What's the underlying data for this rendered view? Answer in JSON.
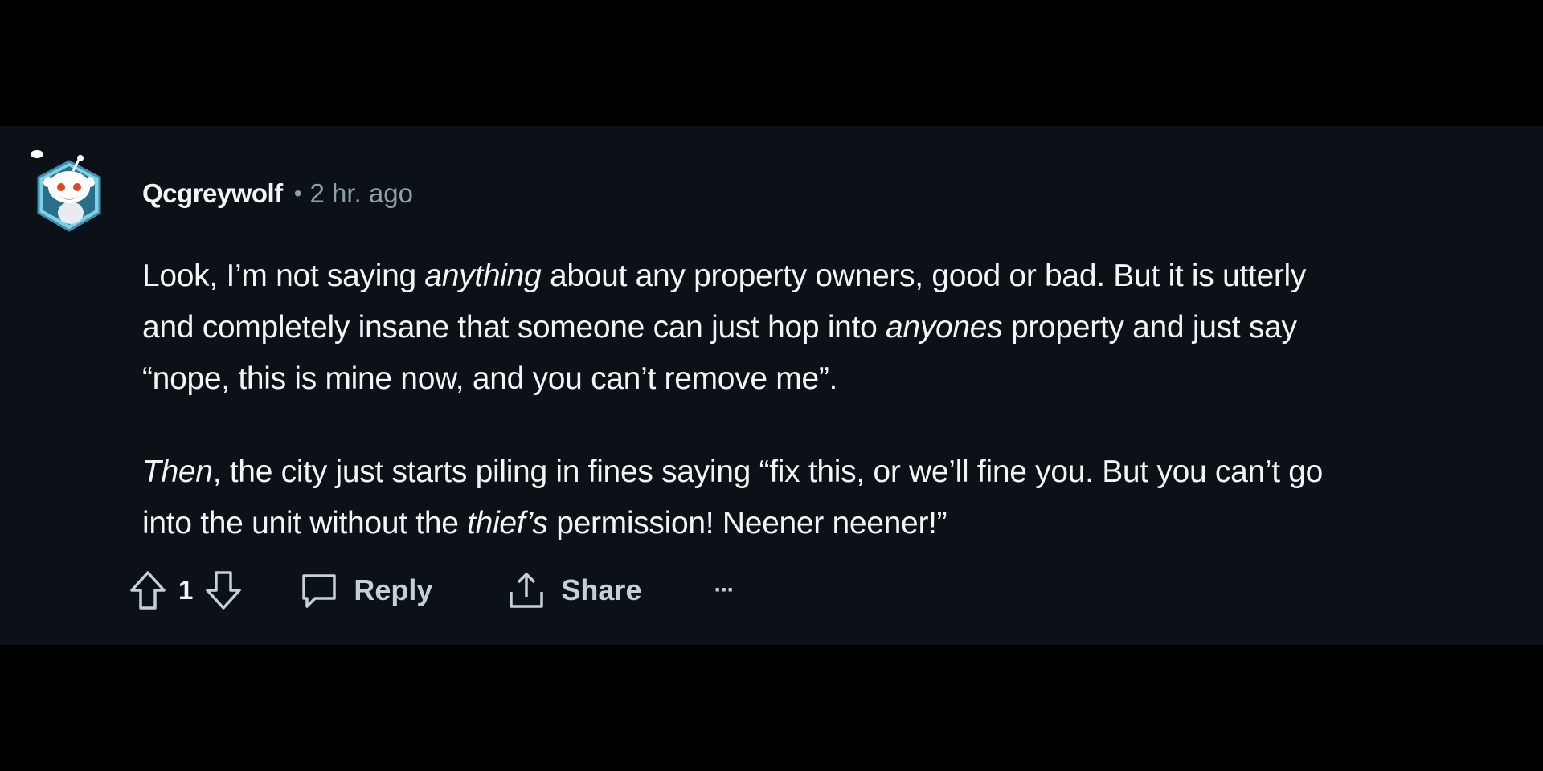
{
  "comment": {
    "username": "Qcgreywolf",
    "separator": "•",
    "time_ago": "2 hr. ago",
    "paragraphs": [
      {
        "lines": [
          [
            {
              "text": "Look, I’m not saying ",
              "italic": false
            },
            {
              "text": "anything",
              "italic": true
            },
            {
              "text": " about any property owners, good or bad. But it is utterly",
              "italic": false
            }
          ],
          [
            {
              "text": "and completely insane that someone can just hop into ",
              "italic": false
            },
            {
              "text": "anyones",
              "italic": true
            },
            {
              "text": " property and just say",
              "italic": false
            }
          ],
          [
            {
              "text": "“nope, this is mine now, and you can’t remove me”.",
              "italic": false
            }
          ]
        ]
      },
      {
        "lines": [
          [
            {
              "text": "Then",
              "italic": true
            },
            {
              "text": ", the city just starts piling in fines saying “fix this, or we’ll fine you. But you can’t go",
              "italic": false
            }
          ],
          [
            {
              "text": "into the unit without the ",
              "italic": false
            },
            {
              "text": "thief’s",
              "italic": true
            },
            {
              "text": " permission! Neener neener!”",
              "italic": false
            }
          ]
        ]
      }
    ]
  },
  "actions": {
    "upvote_icon": "upvote-arrow-icon",
    "score": "1",
    "downvote_icon": "downvote-arrow-icon",
    "reply_label": "Reply",
    "reply_icon": "speech-bubble-icon",
    "share_label": "Share",
    "share_icon": "share-arrow-icon",
    "more_label": "···",
    "more_icon": "ellipsis-icon"
  },
  "colors": {
    "page_background": "#000000",
    "card_background": "#0b1116",
    "text_primary": "#f2f4f5",
    "text_secondary": "#8ba2ad",
    "action_color": "#c5d0d6"
  }
}
